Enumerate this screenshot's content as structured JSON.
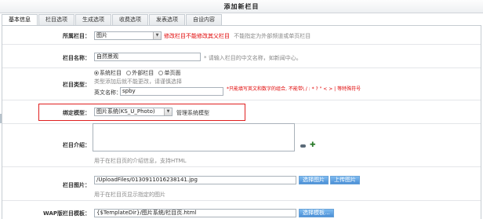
{
  "page_title": "添加新栏目",
  "tabs": [
    "基本信息",
    "栏目选项",
    "生成选项",
    "收费选项",
    "发表选项",
    "自设内容"
  ],
  "parent": {
    "label": "所属栏目：",
    "value": "图片",
    "note": "修改栏目不能修改其父栏目",
    "hint": "不能指定为外部频道或单页栏目"
  },
  "name": {
    "label": "栏目名称：",
    "value": "自然景观",
    "hint": "* 请输入栏目的中文名称，如新闻中心。"
  },
  "type": {
    "label": "栏目类型：",
    "options": [
      "系统栏目",
      "外部栏目",
      "单页面"
    ],
    "selected": 0,
    "hint": "类型添加后就不能更改，请谨慎选择",
    "en_label": "英文名称：",
    "en_value": "spby",
    "en_warning": "*只能填写英文和数字的组合, 不能带\\ / : * ? \" < > | 等特殊符号"
  },
  "model": {
    "label": "绑定模型：",
    "value": "图片系统(KS_U_Photo)",
    "manage": "管理系统模型"
  },
  "intro": {
    "label": "栏目介绍：",
    "hint": "用于在栏目页的介绍信息，支持HTML"
  },
  "image": {
    "label": "栏目图片：",
    "value": "/UploadFiles/0130911016238141.jpg",
    "btn_select": "选择图片",
    "btn_upload": "上传图片",
    "hint": "用于在栏目页显示指定的图片"
  },
  "wap": {
    "label": "WAP版栏目模板：",
    "value": "{$TemplateDir}/图片系统/栏目页.html",
    "btn_select": "选择模板..."
  },
  "colors": {
    "highlight": "#e02020",
    "warning": "#e00000",
    "button": "#4a8fd6"
  }
}
